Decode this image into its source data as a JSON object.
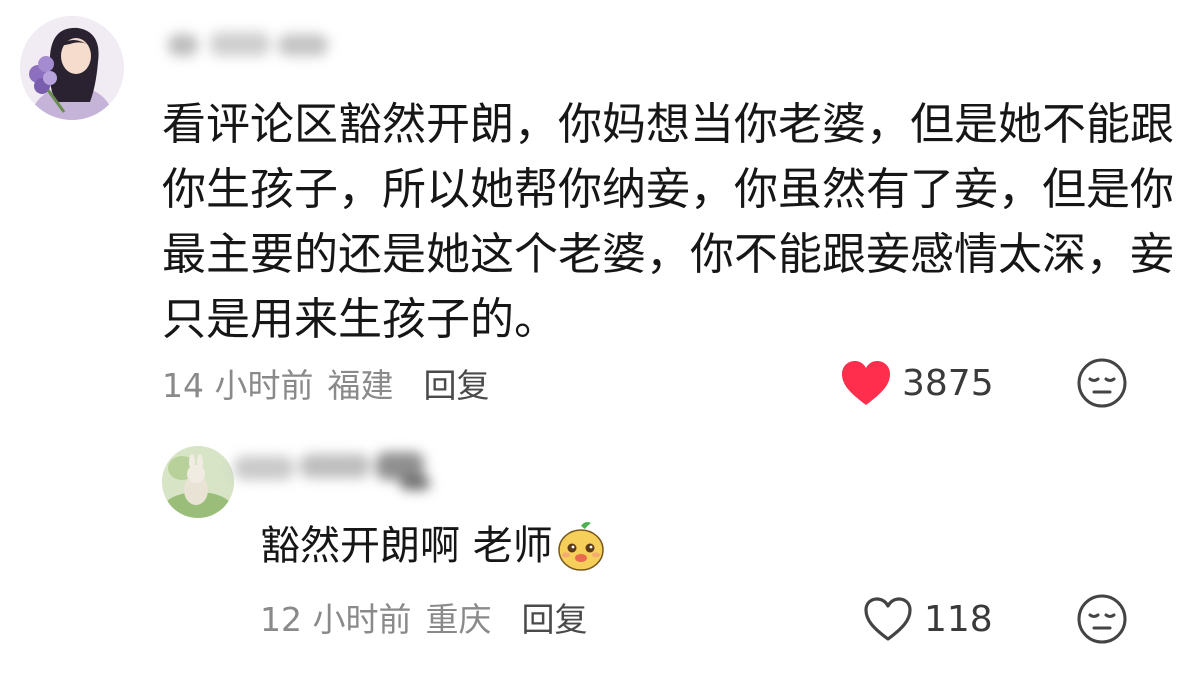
{
  "comment": {
    "text_lines": [
      "看评论区豁然开朗，你妈想当你老婆，但是她不能跟",
      "你生孩子，所以她帮你纳妾，你虽然有了妾，但是你",
      "最主要的还是她这个老婆，你不能跟妾感情太深，妾",
      "只是用来生孩子的。"
    ],
    "time": "14 小时前",
    "location": "福建",
    "reply_label": "回复",
    "likes": "3875",
    "liked": true
  },
  "reply": {
    "text": "豁然开朗啊 老师",
    "time": "12 小时前",
    "location": "重庆",
    "reply_label": "回复",
    "likes": "118",
    "liked": false
  },
  "colors": {
    "heart_active": "#ff2e4d",
    "heart_inactive_stroke": "#444444",
    "meta_text": "#8a8a8a",
    "body_text": "#161616"
  },
  "icons": {
    "like_active": "heart-filled-icon",
    "like_inactive": "heart-outline-icon",
    "dislike": "expressionless-face-icon",
    "sticker": "cartoon-face-sticker"
  }
}
